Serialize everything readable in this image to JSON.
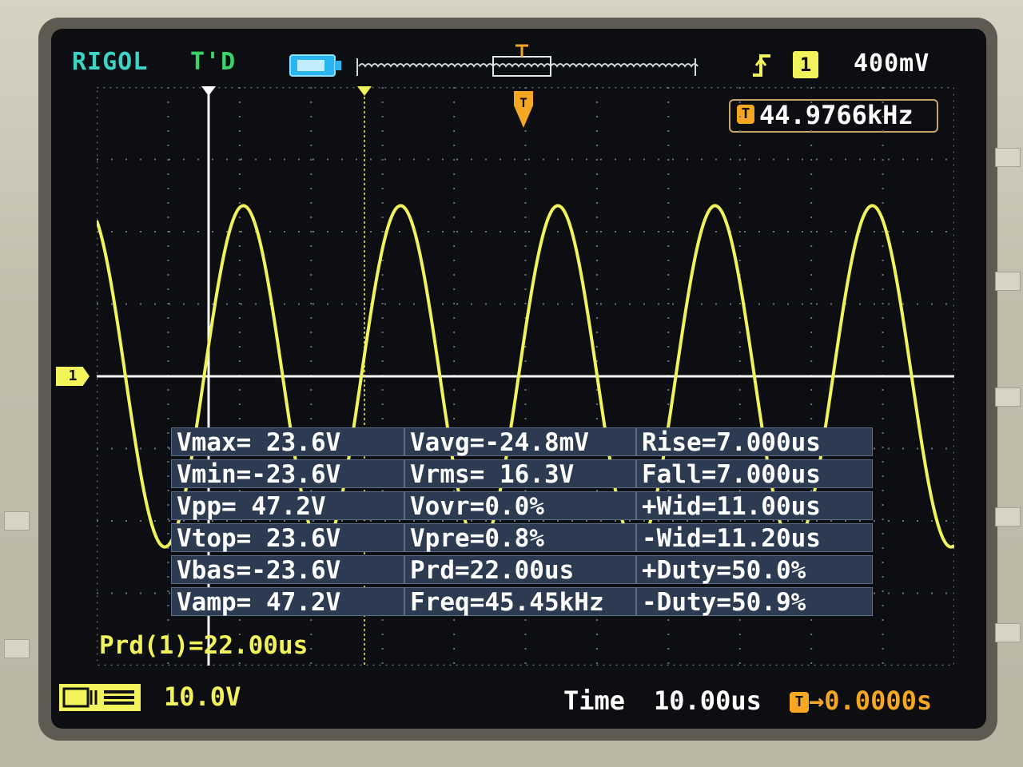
{
  "header": {
    "brand": "RIGOL",
    "run_state": "T'D",
    "trigger_channel": "1",
    "trigger_level": "400mV"
  },
  "frequency_counter": {
    "icon_label": "T",
    "value": "44.9766kHz"
  },
  "channel_marker": "1",
  "measurements": {
    "col1": [
      "Vmax= 23.6V",
      "Vmin=-23.6V",
      "Vpp= 47.2V",
      "Vtop= 23.6V",
      "Vbas=-23.6V",
      "Vamp= 47.2V"
    ],
    "col2": [
      "Vavg=-24.8mV",
      "Vrms= 16.3V",
      "Vovr=0.0%",
      "Vpre=0.8%",
      "Prd=22.00us",
      "Freq=45.45kHz"
    ],
    "col3": [
      "Rise=7.000us",
      "Fall=7.000us",
      "+Wid=11.00us",
      "-Wid=11.20us",
      "+Duty=50.0%",
      "-Duty=50.9%"
    ]
  },
  "cursor_readout": "Prd(1)=22.00us",
  "footer": {
    "ch1_scale": "10.0V",
    "time_label": "Time",
    "time_scale": "10.00us",
    "trigger_icon": "T",
    "trigger_offset": "→0.0000s"
  },
  "colors": {
    "trace": "#f2f25a",
    "brand": "#3bd3c6",
    "trigger": "#f5a623",
    "panel": "#2d3b52",
    "grid": "#6a6f78"
  },
  "waveform": {
    "amplitude_v": 23.6,
    "frequency_khz": 45.45,
    "volts_per_div": 10.0,
    "time_per_div_us": 10.0
  },
  "icons": {
    "battery": "battery-icon",
    "trigger_edge": "rising-edge-icon",
    "trigger_position": "trigger-position-icon"
  }
}
